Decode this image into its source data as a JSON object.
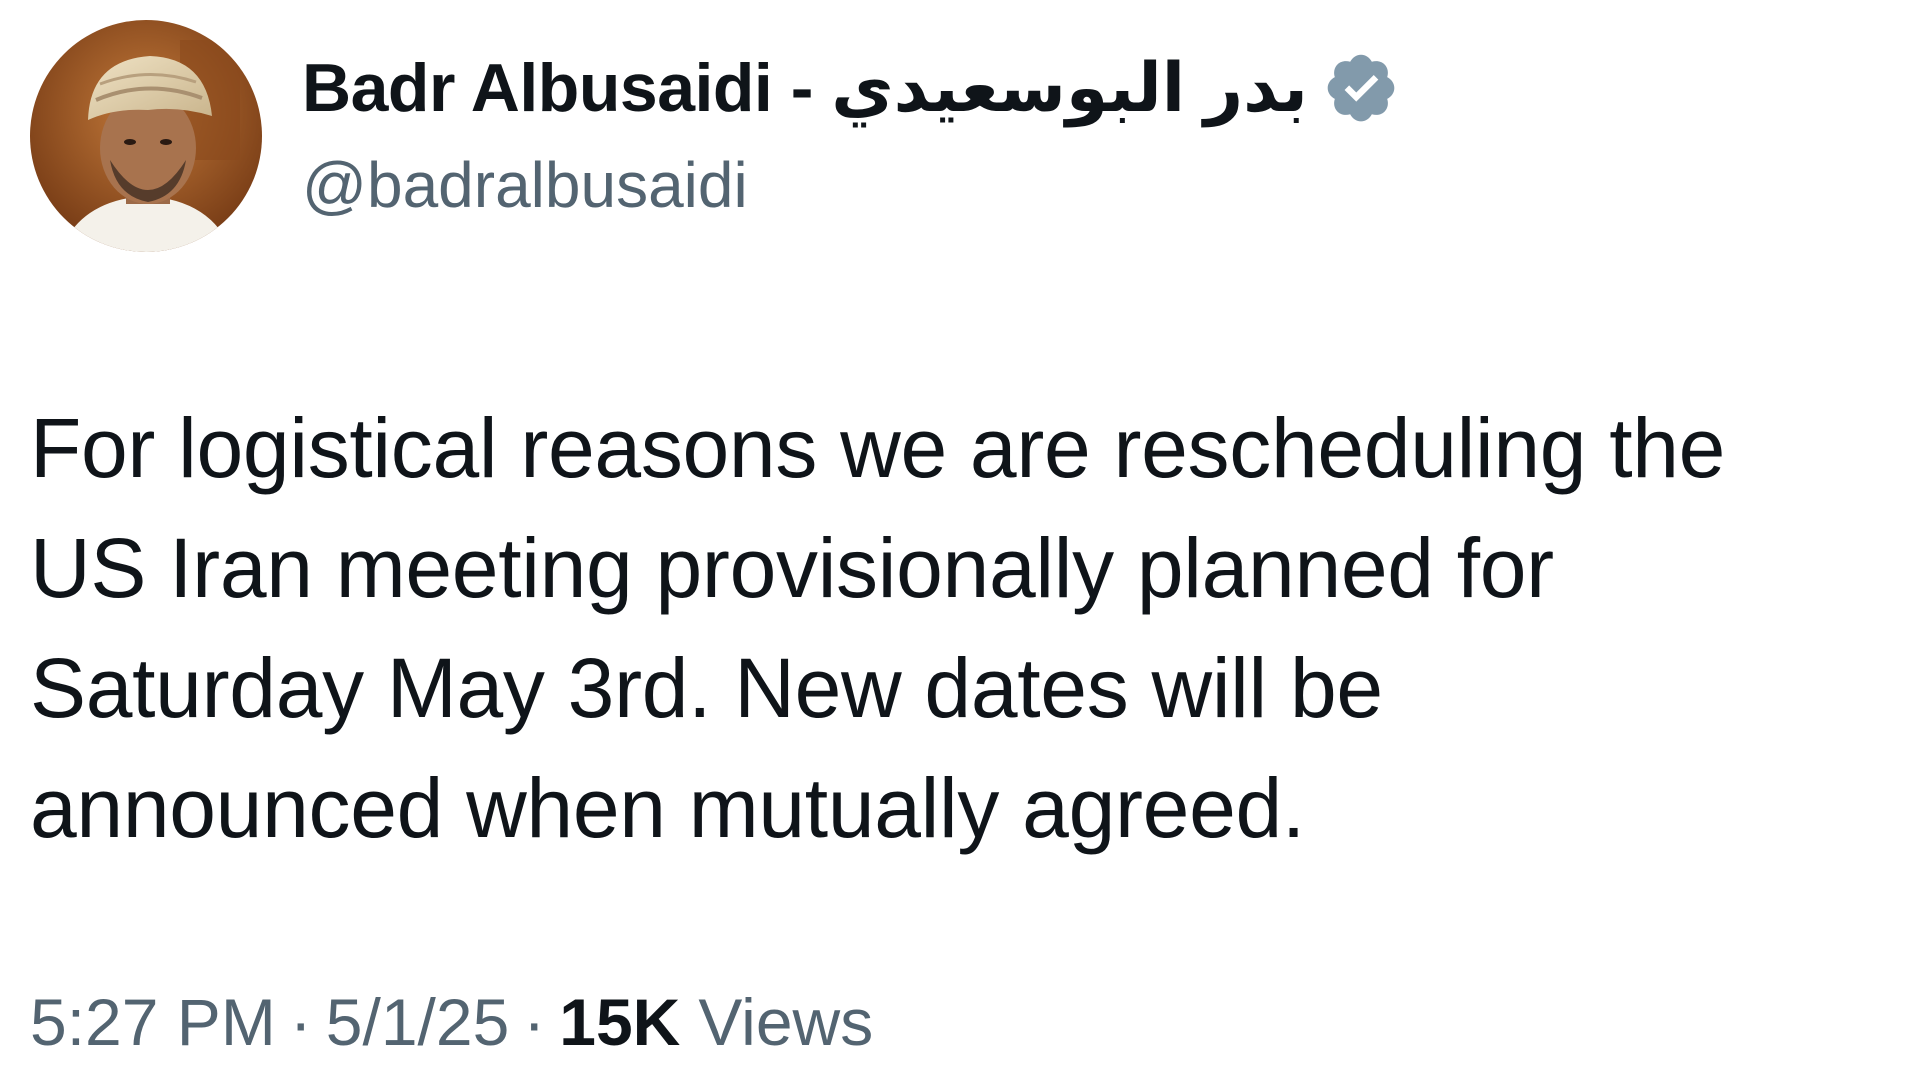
{
  "author": {
    "display_name": "Badr Albusaidi - بدر البوسعيدي",
    "handle": "@badralbusaidi",
    "verified": true,
    "badge_icon": "verified-badge-icon",
    "badge_color": "#829aab"
  },
  "tweet": {
    "text": "For logistical reasons we are rescheduling the\nUS Iran meeting provisionally planned for\nSaturday May 3rd. New dates will be\nannounced when mutually agreed."
  },
  "meta": {
    "time": "5:27 PM",
    "separator": "·",
    "date": "5/1/25",
    "views_count": "15K",
    "views_label": "Views"
  }
}
